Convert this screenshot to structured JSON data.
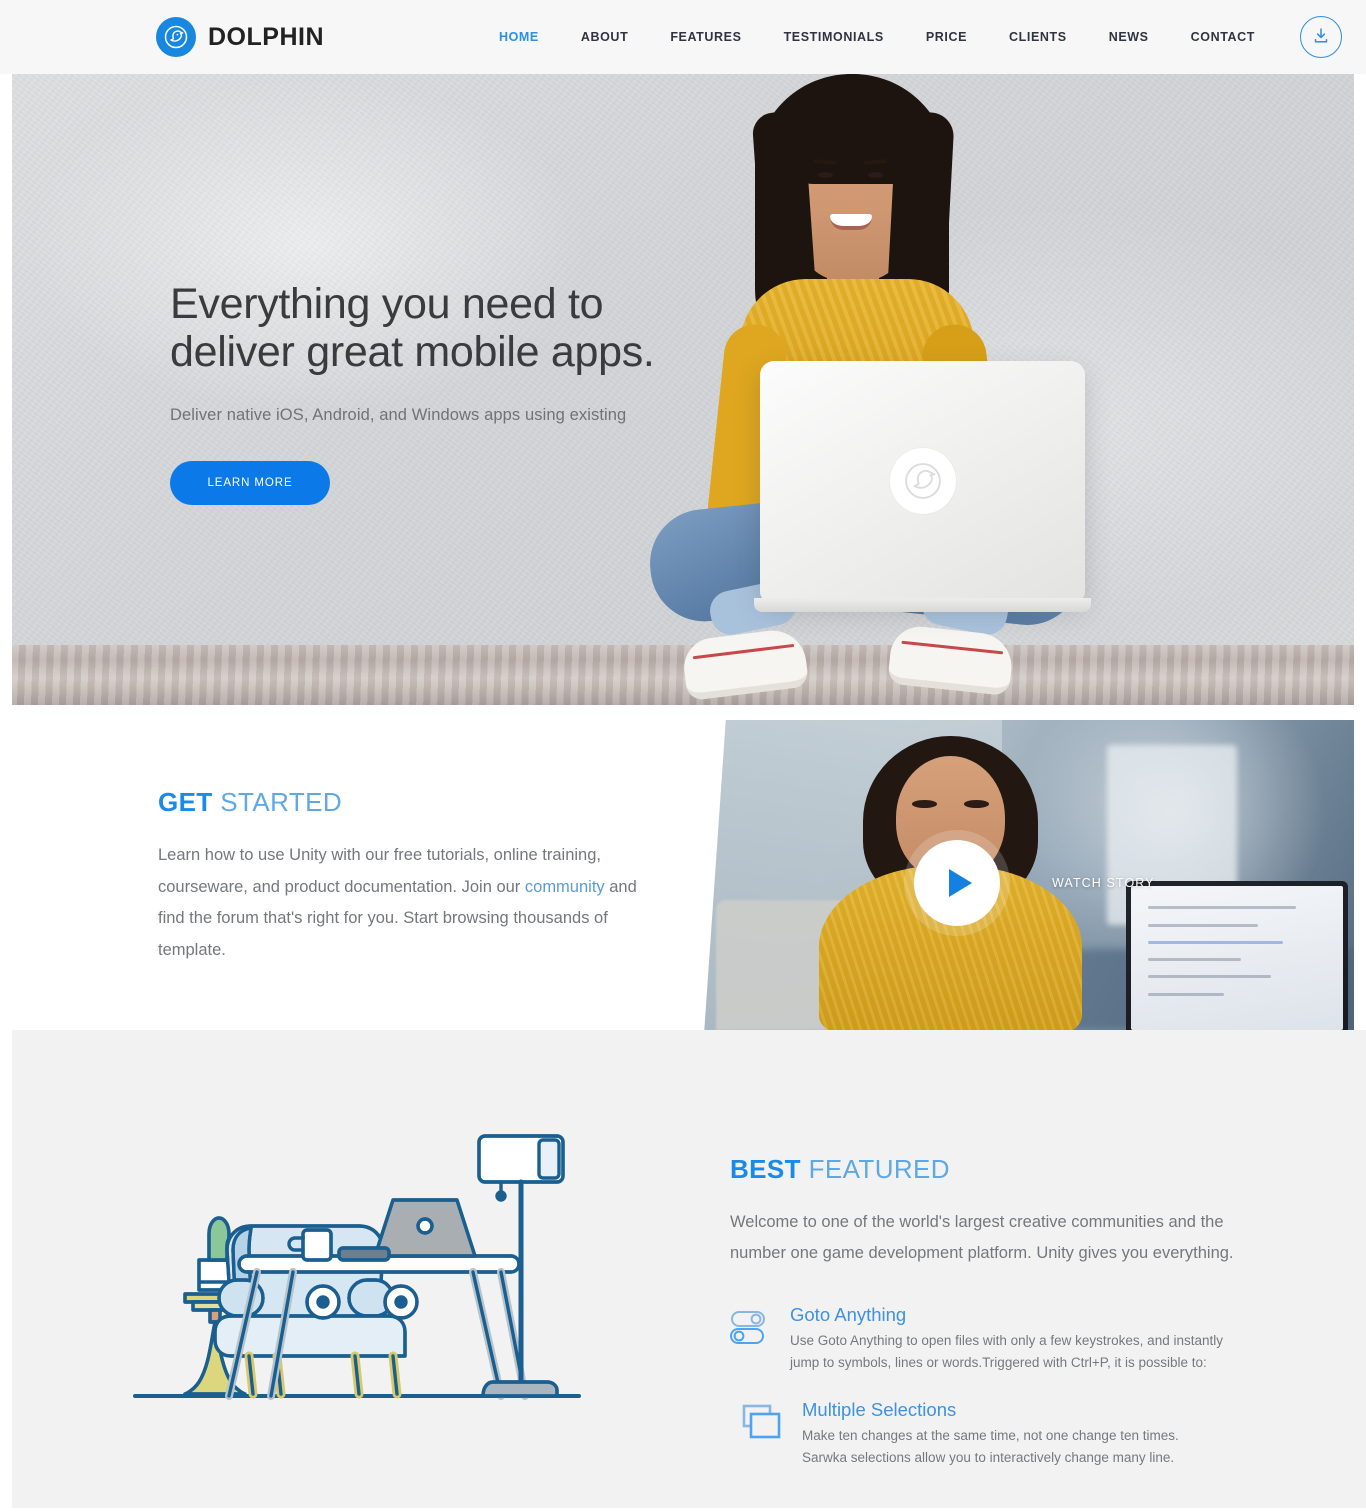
{
  "brand": {
    "name": "DOLPHIN",
    "logo_icon": "dolphin-logo-icon",
    "accent": "#1787e0"
  },
  "nav": {
    "items": [
      {
        "label": "HOME",
        "active": true
      },
      {
        "label": "ABOUT",
        "active": false
      },
      {
        "label": "FEATURES",
        "active": false
      },
      {
        "label": "TESTIMONIALS",
        "active": false
      },
      {
        "label": "PRICE",
        "active": false
      },
      {
        "label": "CLIENTS",
        "active": false
      },
      {
        "label": "NEWS",
        "active": false
      },
      {
        "label": "CONTACT",
        "active": false
      }
    ],
    "download_icon": "download-icon"
  },
  "hero": {
    "title_line1": "Everything you need to",
    "title_line2": "deliver great mobile apps.",
    "subtitle": "Deliver native iOS, Android, and Windows apps using existing",
    "cta_label": "LEARN MORE",
    "cta_color": "#0b7ae8"
  },
  "get_started": {
    "title_strong": "GET",
    "title_light": "STARTED",
    "body_part1": "Learn how to use Unity with our free tutorials, online training, courseware, and product documentation. Join our ",
    "link_text": "community",
    "body_part2": " and find the forum that's right for you. Start browsing thousands of template.",
    "watch_label": "WATCH STORY",
    "play_icon": "play-icon"
  },
  "best_featured": {
    "title_strong": "BEST",
    "title_light": "FEATURED",
    "body": "Welcome to one of the world's largest creative communities and the number one game development platform. Unity gives you everything.",
    "illustration_icon": "workspace-desk-illustration",
    "features": [
      {
        "icon": "toggle-switches-icon",
        "name": "Goto Anything",
        "desc_line1": "Use Goto Anything to open files with only a few keystrokes, and instantly",
        "desc_line2": "jump to symbols, lines or words.Triggered with Ctrl+P, it is possible to:"
      },
      {
        "icon": "multiple-selections-icon",
        "name": "Multiple Selections",
        "desc_line1": "Make ten changes at the same time, not one change ten times.",
        "desc_line2": "Sarwka selections allow you to interactively change many line."
      }
    ]
  }
}
